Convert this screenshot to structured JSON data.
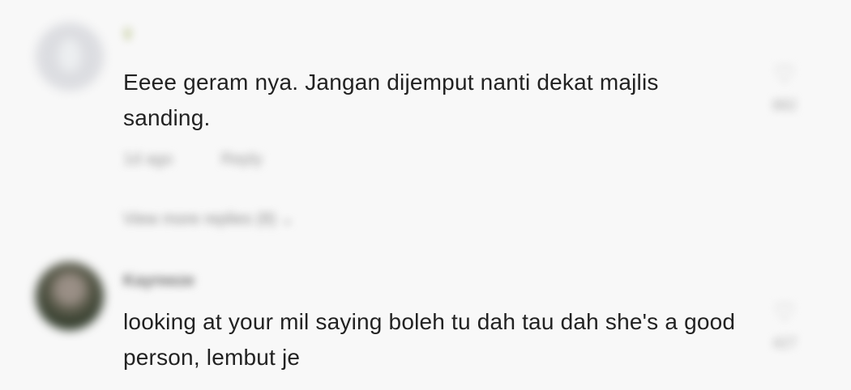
{
  "comments": [
    {
      "username": "ṽ",
      "text": "Eeee geram nya. Jangan dijemput nanti dekat majlis sanding.",
      "meta": {
        "time": "1d ago",
        "reply": "Reply"
      },
      "view_replies": "View more replies (8) ⌄",
      "like": {
        "icon": "♡",
        "count": "882"
      }
    },
    {
      "username": "Kayreeze",
      "text": "looking at your mil saying boleh tu dah tau dah she's a good person, lembut je",
      "like": {
        "icon": "♡",
        "count": "427"
      }
    }
  ]
}
